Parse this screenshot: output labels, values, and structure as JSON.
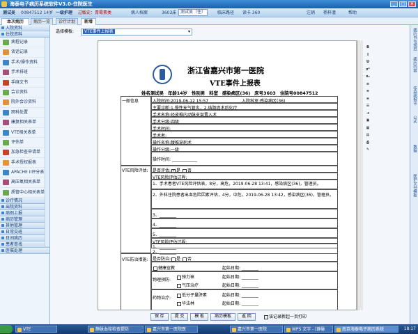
{
  "window": {
    "title": "海泰电子病历系统软件V3.0-住院医生"
  },
  "infobar": {
    "patient": "测试吴",
    "id_text": "00847512 14岁",
    "grade": "一级护理",
    "allergy": "过敏史：青霉素类",
    "patients_btn": "病人档案",
    "bed_select": "3603床",
    "bed_name": "测试吴（住）",
    "clinical_path": "临床路径",
    "read_card": "读卡 360",
    "logout": "注销",
    "user": "杨梓潼",
    "help": "帮助"
  },
  "tabs": [
    {
      "label": "本次病历"
    },
    {
      "label": "病历一览"
    },
    {
      "label": "诊疗计划"
    },
    {
      "label": "新增"
    }
  ],
  "sidebar": {
    "group1": "入院资料",
    "group2": "住院资料",
    "items": [
      {
        "label": "病程记录"
      },
      {
        "label": "谈话记录"
      },
      {
        "label": "手术/操作资料"
      },
      {
        "label": "手术排班"
      },
      {
        "label": "手麻文书"
      },
      {
        "label": "会诊资料"
      },
      {
        "label": "院外会诊资料"
      },
      {
        "label": "跨科处置"
      },
      {
        "label": "康复相关表单"
      },
      {
        "label": "VTE相关表单"
      },
      {
        "label": "评估单"
      },
      {
        "label": "加急检查申请单"
      },
      {
        "label": "手术授权报表"
      },
      {
        "label": "APACHE II评分表"
      },
      {
        "label": "高压氧相关表单"
      },
      {
        "label": "质管中心相关表单"
      }
    ],
    "bottom": [
      {
        "label": "诊疗情况"
      },
      {
        "label": "出院资料"
      },
      {
        "label": "病例上报"
      },
      {
        "label": "病历管理"
      },
      {
        "label": "其他管理"
      },
      {
        "label": "日常交班"
      },
      {
        "label": "日间病历"
      },
      {
        "label": "患者查找"
      },
      {
        "label": "医嘱处理"
      }
    ]
  },
  "template": {
    "label": "选择模板:",
    "value": "VTE事件上报表"
  },
  "document": {
    "hospital": "浙江省嘉兴市第一医院",
    "title": "VTE事件上报表",
    "patient": {
      "name": "姓名测试吴",
      "age": "年龄14岁",
      "sex": "性别男",
      "dept": "科室",
      "ward": "感染病区(36)",
      "bed": "床号3603",
      "inpatient_no": "住院号00847512"
    },
    "general": "一般信息",
    "admit_time_label": "入院时间:",
    "admit_time": "2019-06-12 15:57",
    "admit_dept_label": "入院科室:",
    "admit_dept": "感染病区(36)",
    "diagnosis_label": "主要诊断:",
    "diagnosis": "1.慢性支气管炎，2.结肠癌术后化疗",
    "surgery_label": "手术名称:",
    "surgery": "经皮椎内动脉支架置入术",
    "grade_label": "手术分级:",
    "grade": "四级",
    "surgery_time_label": "手术时间:",
    "surgeon_label": "手术者:",
    "op_name_label": "操作名称:",
    "op_name": "腰椎穿刺术",
    "op_grade_label": "操作分级:",
    "op_grade": "一级",
    "op_time_label": "操作时间:",
    "risk_label": "VTE风险评估:",
    "assessed_label": "是否评估:",
    "yes": "是",
    "no": "否",
    "process_label": "VTE风险评估过程:",
    "process1": "1、手术患者VTE风险评估表，8分，高危，2019-06-28 13:41，感染病区(36)，管理员。",
    "process2": "2、外科住院患者出血危险因素评估，4分，中危，2019-06-28 13:42，感染病区(36)，管理员。",
    "p3": "3、",
    "p4": "4、",
    "p5": "5、",
    "measures_process_label": "VTE风险评估过程:",
    "m1": "1、",
    "m2": "2、",
    "prevent_label": "VTE防治措施:",
    "prevent_q": "是否防治:",
    "prevent_no": "否",
    "health_edu": "健康宣教",
    "start_date": "起始日期:",
    "physical_label": "物理预防:",
    "elastic": "弹力袜",
    "pneumatic": "气压治疗",
    "drug_label": "药物治疗:",
    "lmwh": "低分子量肝素",
    "warfarin": "华法林",
    "other": "其他"
  },
  "buttons": {
    "save": "保 存",
    "submit": "提 交",
    "template": "模 板",
    "history": "病历模板",
    "back": "返 回",
    "checkbox": "该记录新起一页打印"
  },
  "rightstrip": [
    "病历书写规范",
    "病历内容",
    "传染病报卡",
    "公式",
    "数据",
    "医护文书模板"
  ],
  "taskbar": {
    "items": [
      "VTE",
      "静脉血栓检查提防",
      "嘉兴市第一医院医",
      "嘉兴市第一医院",
      "WPS 文字 - [静脉",
      "南京海泰电子病历系统"
    ],
    "time": "18:17"
  }
}
